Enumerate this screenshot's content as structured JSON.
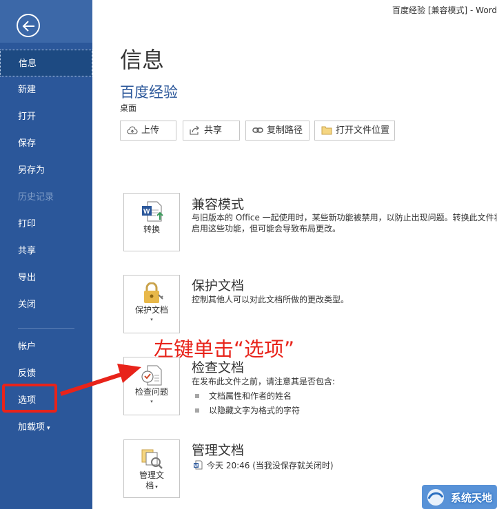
{
  "titlebar": {
    "text": "百度经验 [兼容模式] - Word"
  },
  "sidebar": {
    "items": [
      {
        "label": "信息"
      },
      {
        "label": "新建"
      },
      {
        "label": "打开"
      },
      {
        "label": "保存"
      },
      {
        "label": "另存为"
      },
      {
        "label": "历史记录"
      },
      {
        "label": "打印"
      },
      {
        "label": "共享"
      },
      {
        "label": "导出"
      },
      {
        "label": "关闭"
      }
    ],
    "bottom_items": [
      {
        "label": "帐户"
      },
      {
        "label": "反馈"
      },
      {
        "label": "选项"
      },
      {
        "label": "加载项"
      }
    ],
    "addins_caret": "▾"
  },
  "main": {
    "page_title": "信息",
    "doc_title": "百度经验",
    "doc_location": "桌面",
    "buttons": [
      {
        "label": "上传"
      },
      {
        "label": "共享"
      },
      {
        "label": "复制路径"
      },
      {
        "label": "打开文件位置"
      }
    ],
    "sections": [
      {
        "card_label": "转换",
        "title": "兼容模式",
        "desc_line1": "与旧版本的 Office 一起使用时，某些新功能被禁用，以防止出现问题。转换此文件将",
        "desc_line2": "启用这些功能，但可能会导致布局更改。"
      },
      {
        "card_label": "保护文档",
        "card_caret": "▾",
        "title": "保护文档",
        "desc_line1": "控制其他人可以对此文档所做的更改类型。"
      },
      {
        "card_label": "检查问题",
        "card_caret": "▾",
        "title": "检查文档",
        "desc_line1": "在发布此文件之前，请注意其是否包含:",
        "bullets": [
          "文档属性和作者的姓名",
          "以隐藏文字为格式的字符"
        ]
      },
      {
        "card_label_line1": "管理文",
        "card_label_line2": "档",
        "card_caret": "▾",
        "title": "管理文档",
        "desc_line1": "今天 20:46 (当我没保存就关闭时)"
      }
    ]
  },
  "annotation": {
    "text": "左键单击“选项”"
  },
  "watermark": {
    "text": "系统天地"
  },
  "colors": {
    "sidebar": "#2b579a",
    "sidebar_active": "#1d4a82",
    "accent_red": "#e8231a",
    "doc_title": "#2b579a"
  }
}
